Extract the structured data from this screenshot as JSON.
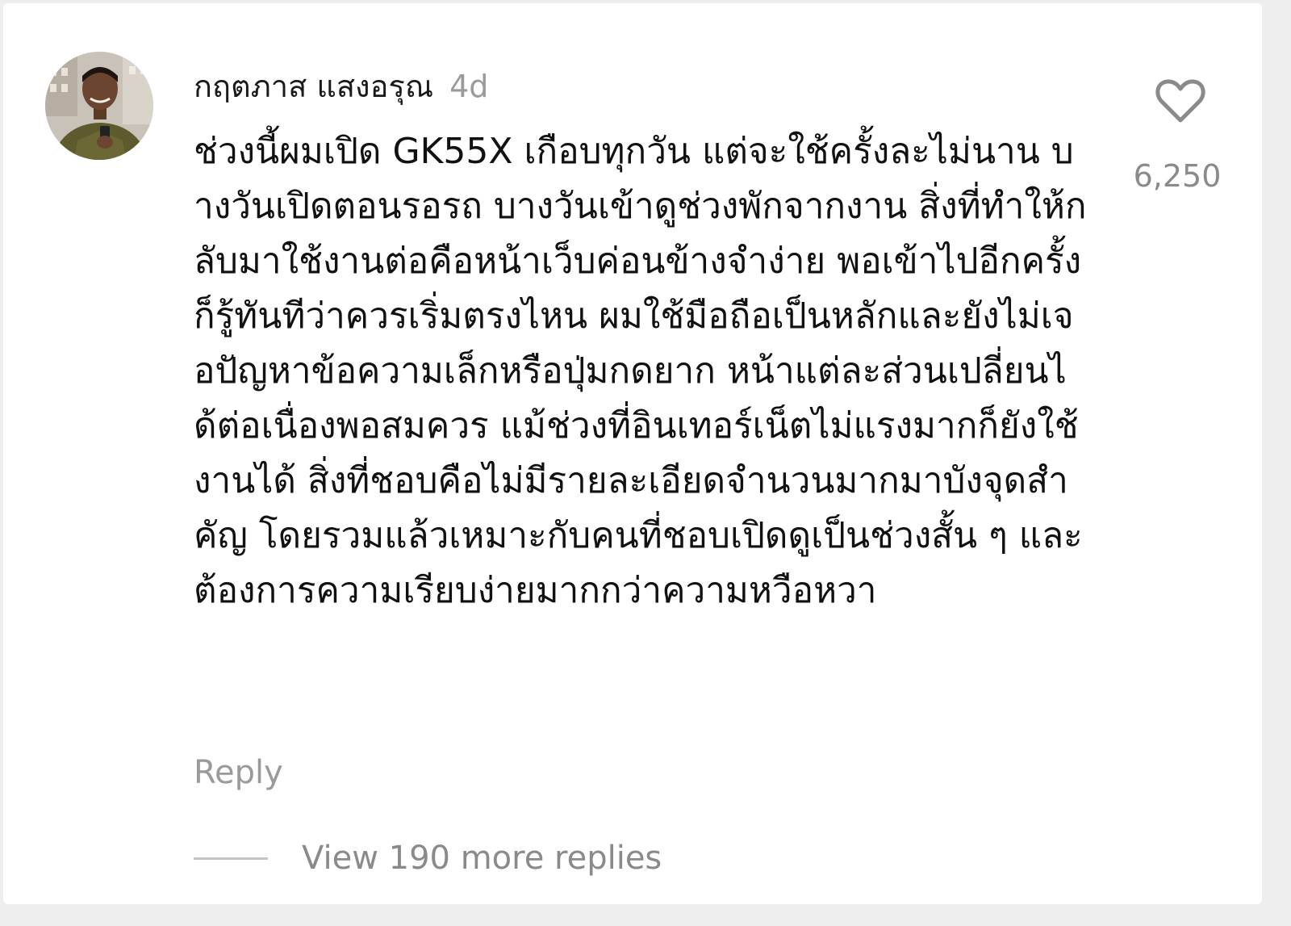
{
  "comment": {
    "username": "กฤตภาส แสงอรุณ",
    "timestamp": "4d",
    "text": "ช่วงนี้ผมเปิด GK55X เกือบทุกวัน แต่จะใช้ครั้งละไม่นาน บางวันเปิดตอนรอรถ บางวันเข้าดูช่วงพักจากงาน สิ่งที่ทำให้กลับมาใช้งานต่อคือหน้าเว็บค่อนข้างจำง่าย พอเข้าไปอีกครั้งก็รู้ทันทีว่าควรเริ่มตรงไหน ผมใช้มือถือเป็นหลักและยังไม่เจอปัญหาข้อความเล็กหรือปุ่มกดยาก หน้าแต่ละส่วนเปลี่ยนได้ต่อเนื่องพอสมควร แม้ช่วงที่อินเทอร์เน็ตไม่แรงมากก็ยังใช้งานได้ สิ่งที่ชอบคือไม่มีรายละเอียดจำนวนมากมาบังจุดสำคัญ โดยรวมแล้วเหมาะกับคนที่ชอบเปิดดูเป็นช่วงสั้น ๆ และต้องการความเรียบง่ายมากกว่าความหวือหวา",
    "like_count": "6,250",
    "reply_label": "Reply",
    "view_replies_label": "View 190 more replies"
  },
  "icons": {
    "like": "heart-outline-icon",
    "avatar": "user-avatar-photo"
  },
  "colors": {
    "text_primary": "#111111",
    "text_secondary": "#8a8a8a",
    "background": "#ffffff",
    "icon": "#8a8a8a"
  }
}
